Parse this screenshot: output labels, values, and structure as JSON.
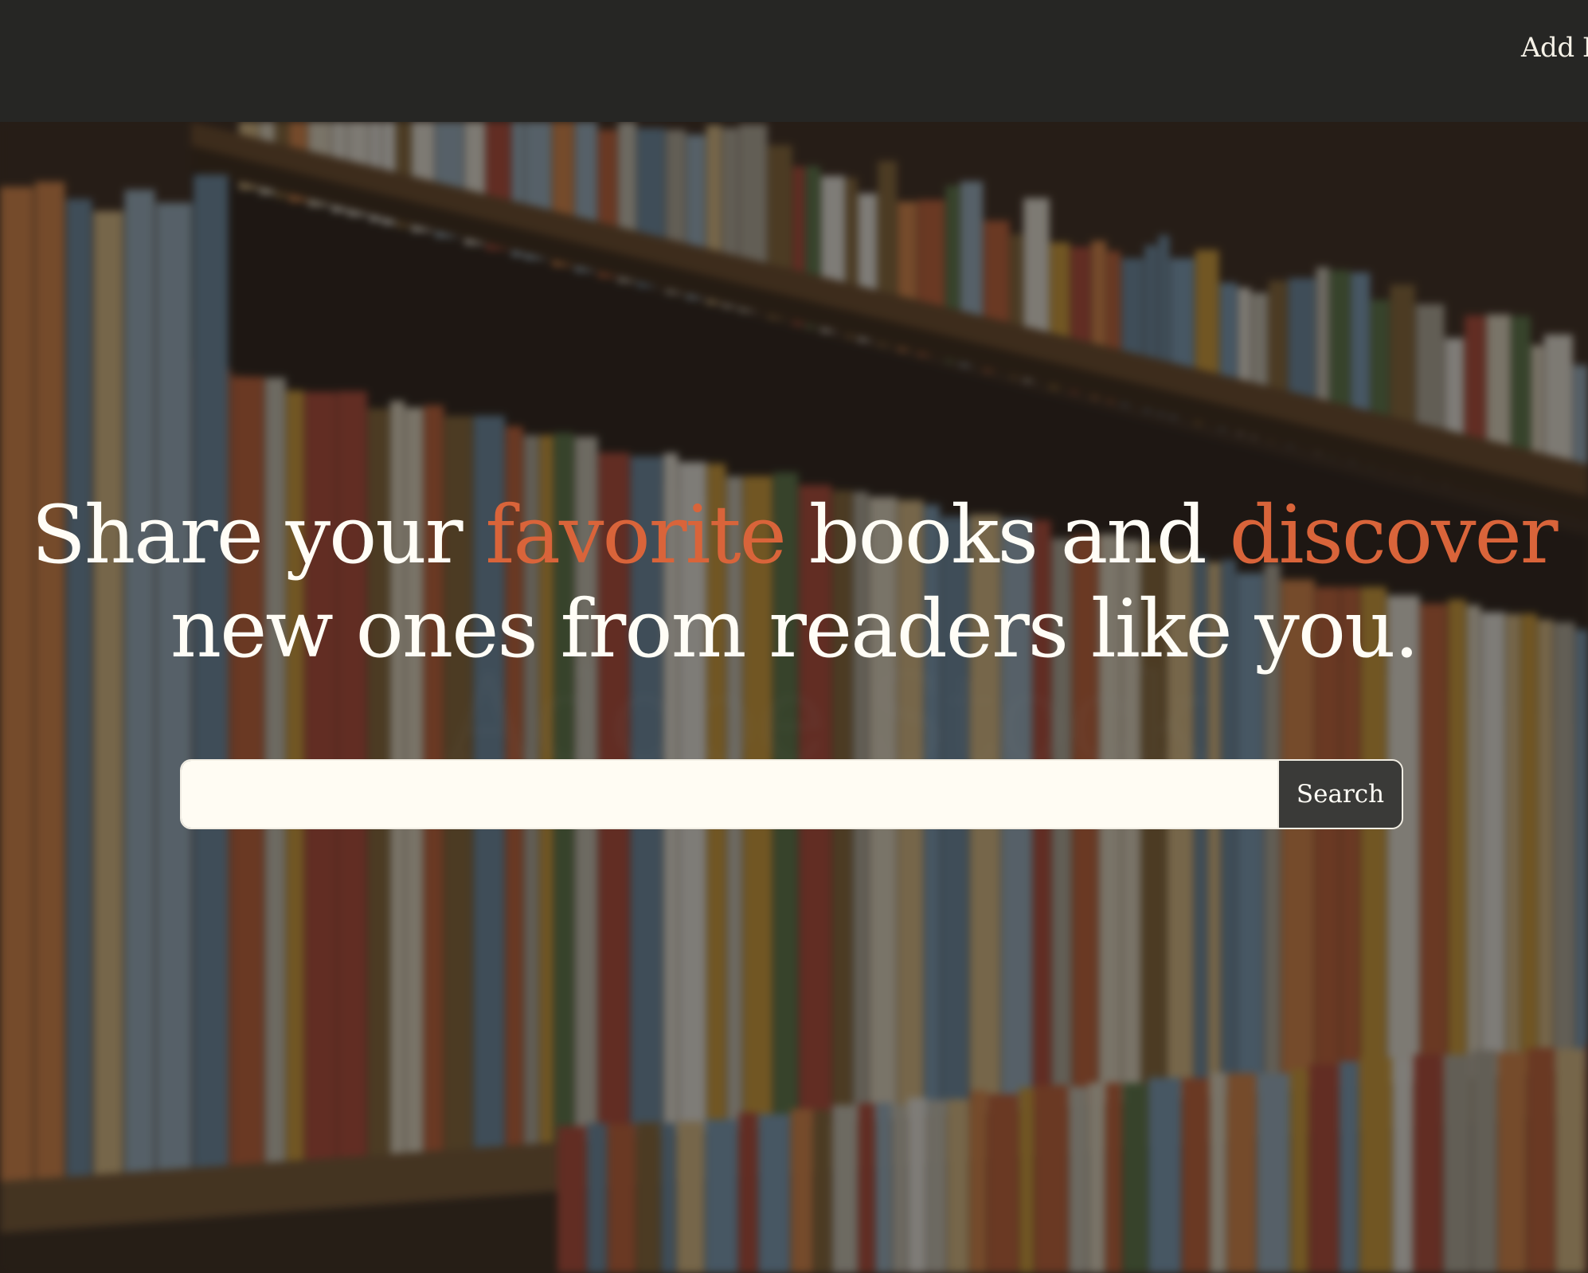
{
  "nav": {
    "add_link": "Add B"
  },
  "hero": {
    "headline_part1": "Share your ",
    "headline_accent1": "favorite",
    "headline_part2": " books and ",
    "headline_accent2": "discover",
    "headline_part3": " new ones from readers like you."
  },
  "search": {
    "input_value": "",
    "button_label": "Search"
  },
  "colors": {
    "accent": "#d9643a",
    "topbar": "#262624",
    "text_light": "#fffdf6",
    "input_bg": "#fffcf3",
    "button_bg": "#3a3a38"
  }
}
